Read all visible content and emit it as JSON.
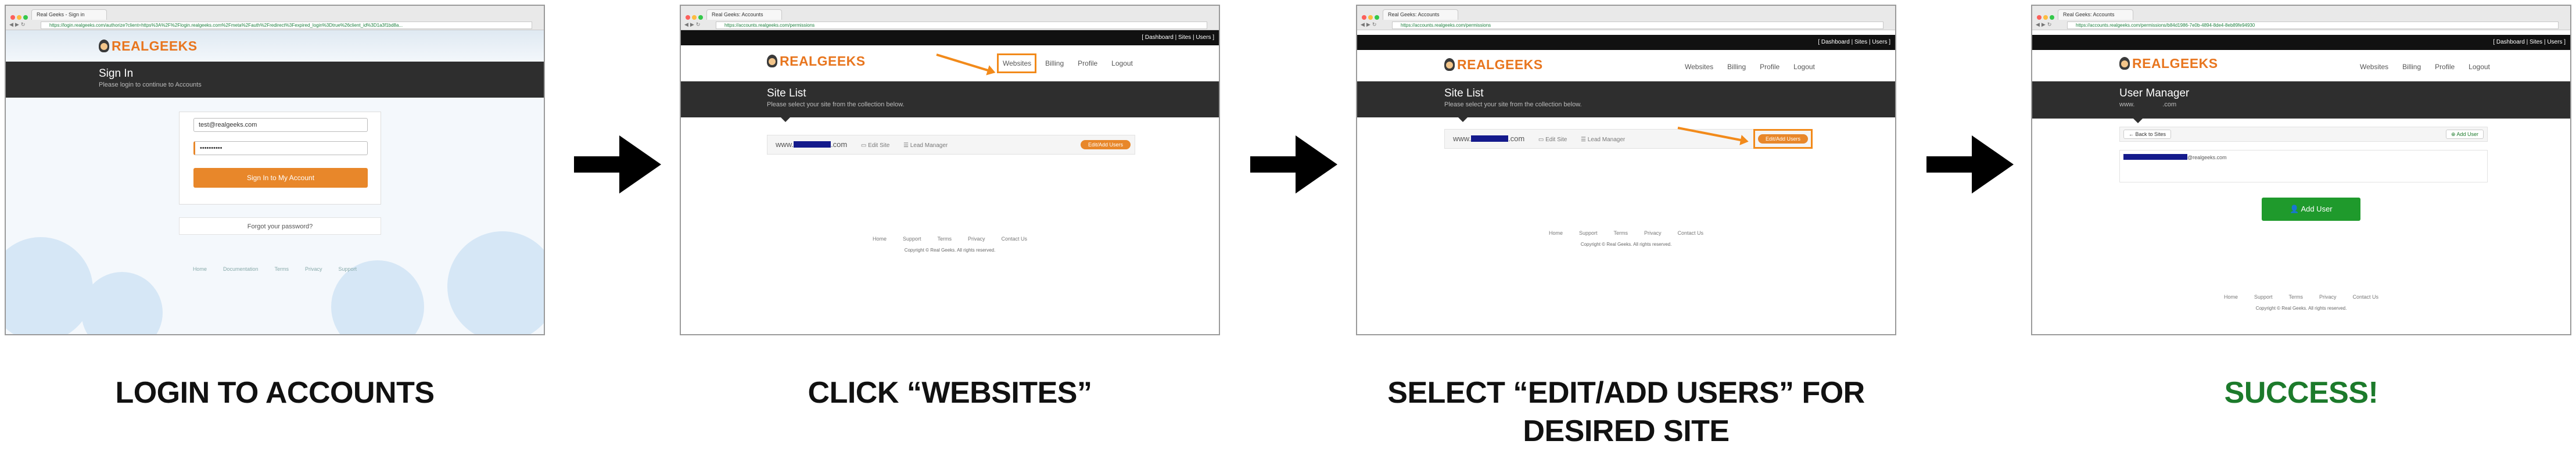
{
  "colors": {
    "accent": "#e8872a",
    "highlight": "#f28a1a",
    "dark_band": "#2e2e2e",
    "success_green": "#1c7a2b",
    "redaction": "#141a8c"
  },
  "step1": {
    "tab": "Real Geeks - Sign in",
    "url": "https://login.realgeeks.com/authorize?client=https%3A%2F%2Flogin.realgeeks.com%2Fmeta%2Fauth%2Fredirect%3Fexpired_login%3Dtrue%26client_id%3D1a3f1bd8a...",
    "logo": "REALGEEKS",
    "title": "Sign In",
    "subtitle": "Please login to continue to Accounts",
    "email_value": "test@realgeeks.com",
    "password_value": "••••••••••",
    "signin_button": "Sign In to My Account",
    "forgot_link": "Forgot your password?",
    "footer": [
      "Home",
      "Documentation",
      "Terms",
      "Privacy",
      "Support"
    ],
    "caption": "LOGIN TO ACCOUNTS"
  },
  "step2": {
    "tab": "Real Geeks: Accounts",
    "url": "https://accounts.realgeeks.com/permissions",
    "topbar": "[ Dashboard | Sites | Users ]",
    "logo": "REALGEEKS",
    "nav": [
      "Websites",
      "Billing",
      "Profile",
      "Logout"
    ],
    "title": "Site List",
    "subtitle": "Please select your site from the collection below.",
    "site_prefix": "www.",
    "site_suffix": ".com",
    "edit_site": "Edit Site",
    "lead_manager": "Lead Manager",
    "edit_users_button": "Edit/Add Users",
    "footer": [
      "Home",
      "Support",
      "Terms",
      "Privacy",
      "Contact Us"
    ],
    "copyright": "Copyright © Real Geeks. All rights reserved.",
    "caption": "CLICK  “WEBSITES”"
  },
  "step3": {
    "tab": "Real Geeks: Accounts",
    "url": "https://accounts.realgeeks.com/permissions",
    "topbar": "[ Dashboard | Sites | Users ]",
    "logo": "REALGEEKS",
    "nav": [
      "Websites",
      "Billing",
      "Profile",
      "Logout"
    ],
    "title": "Site List",
    "subtitle": "Please select your site from the collection below.",
    "site_prefix": "www.",
    "site_suffix": ".com",
    "edit_site": "Edit Site",
    "lead_manager": "Lead Manager",
    "edit_users_button": "Edit/Add Users",
    "footer": [
      "Home",
      "Support",
      "Terms",
      "Privacy",
      "Contact Us"
    ],
    "copyright": "Copyright © Real Geeks. All rights reserved.",
    "caption": "SELECT “EDIT/ADD USERS” FOR DESIRED SITE"
  },
  "step4": {
    "tab": "Real Geeks: Accounts",
    "url": "https://accounts.realgeeks.com/permissions/b84d1986-7e0b-4894-8de4-8eb89fe94930",
    "topbar": "[ Dashboard | Sites | Users ]",
    "logo": "REALGEEKS",
    "nav": [
      "Websites",
      "Billing",
      "Profile",
      "Logout"
    ],
    "title": "User Manager",
    "subtitle_prefix": "www.",
    "subtitle_suffix": ".com",
    "back_button": "← Back to Sites",
    "add_user_small": "⊕ Add User",
    "user_email_suffix": "@realgeeks.com",
    "add_user_button": "Add User",
    "footer": [
      "Home",
      "Support",
      "Terms",
      "Privacy",
      "Contact Us"
    ],
    "copyright": "Copyright © Real Geeks. All rights reserved.",
    "caption": "SUCCESS!"
  }
}
